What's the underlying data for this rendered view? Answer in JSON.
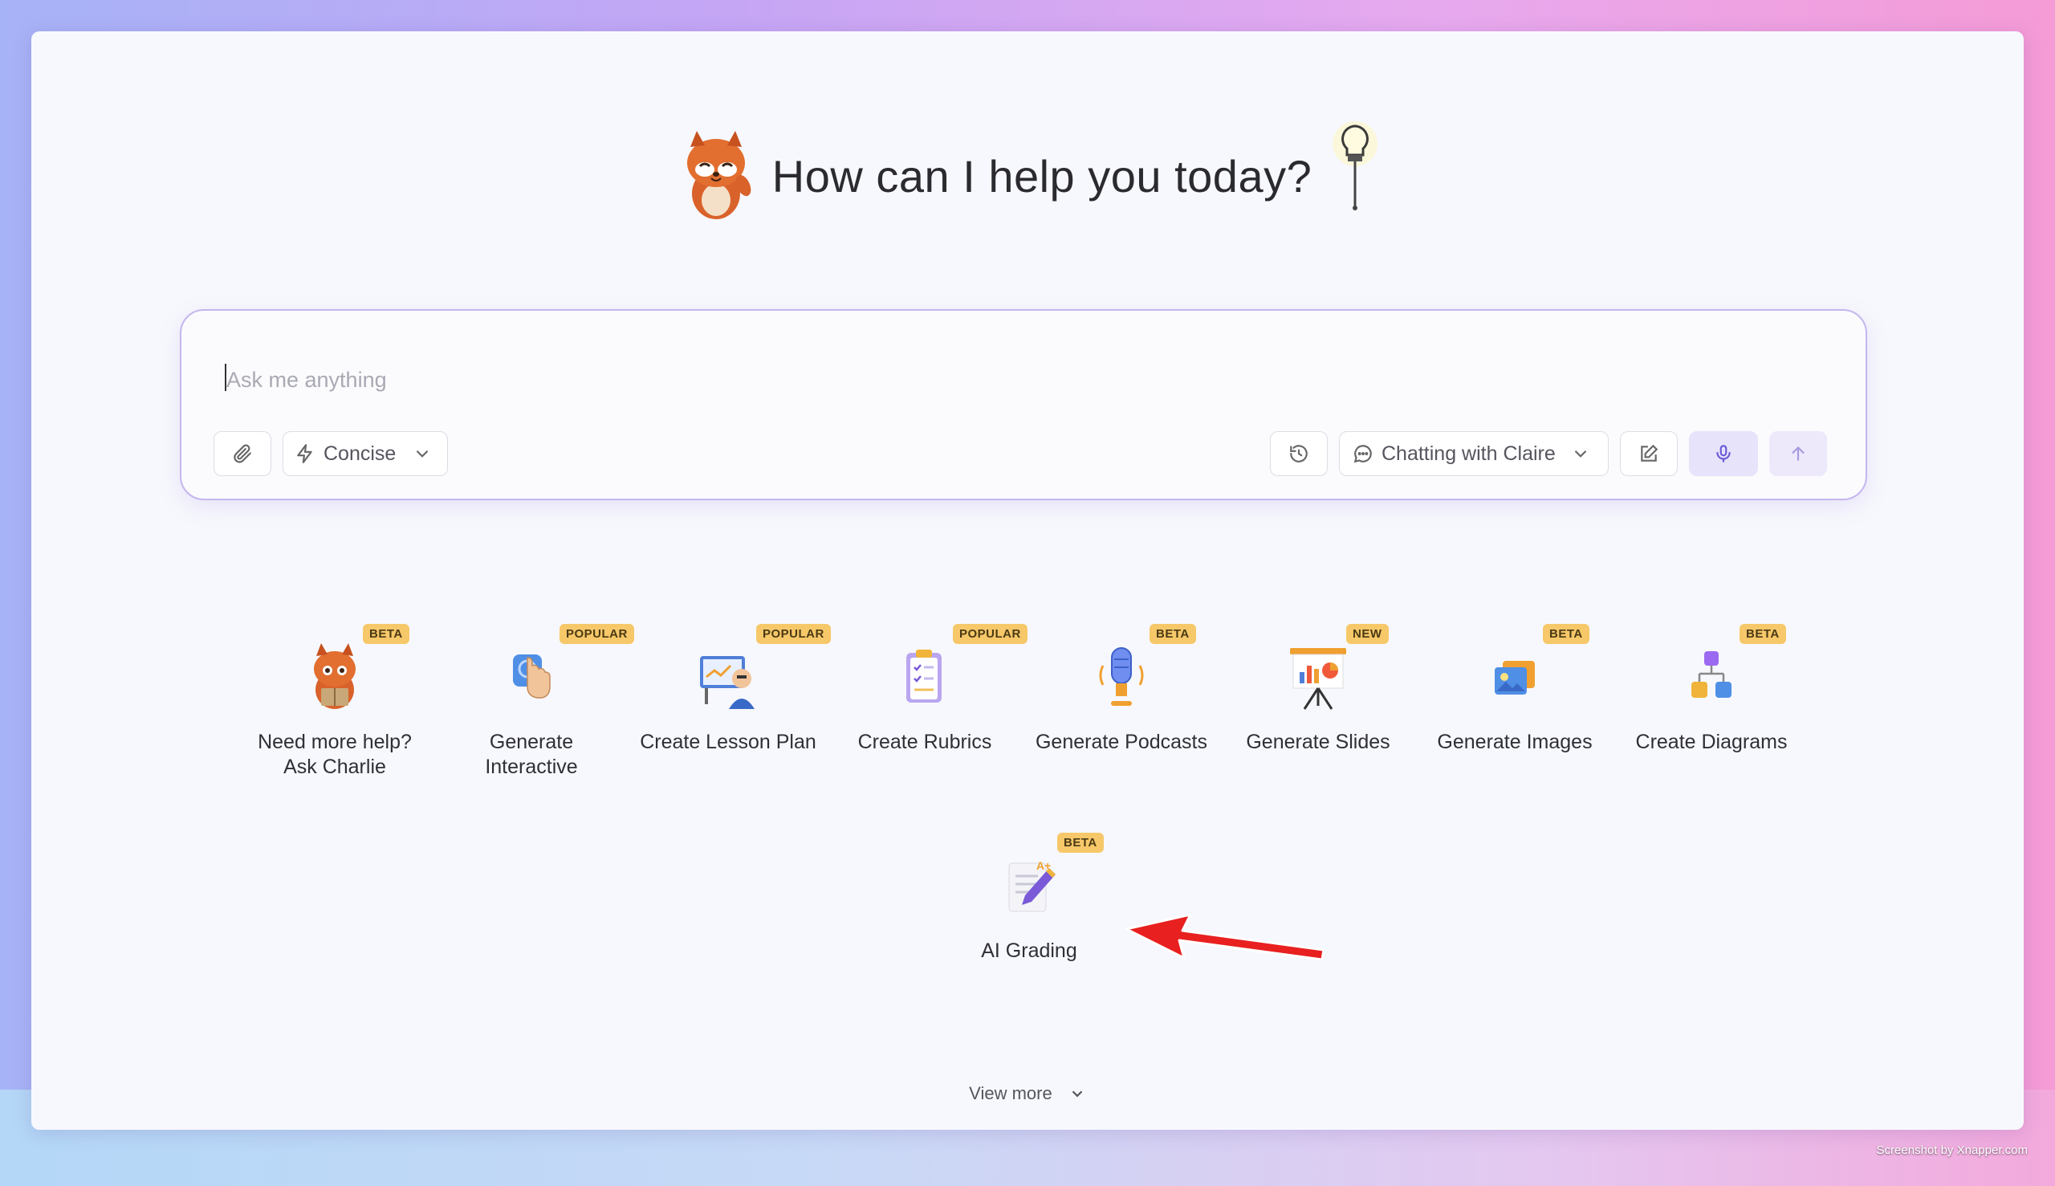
{
  "header": {
    "title": "How can I help you today?"
  },
  "chat": {
    "placeholder": "Ask me anything",
    "mode_label": "Concise",
    "chatting_label": "Chatting with Claire"
  },
  "tools": [
    {
      "label": "Need more help?\nAsk Charlie",
      "badge": "BETA",
      "icon": "fox-reading-icon"
    },
    {
      "label": "Generate\nInteractive",
      "badge": "POPULAR",
      "icon": "tap-hand-icon"
    },
    {
      "label": "Create Lesson Plan",
      "badge": "POPULAR",
      "icon": "teacher-board-icon"
    },
    {
      "label": "Create Rubrics",
      "badge": "POPULAR",
      "icon": "clipboard-icon"
    },
    {
      "label": "Generate Podcasts",
      "badge": "BETA",
      "icon": "microphone-icon"
    },
    {
      "label": "Generate Slides",
      "badge": "NEW",
      "icon": "presentation-icon"
    },
    {
      "label": "Generate Images",
      "badge": "BETA",
      "icon": "images-icon"
    },
    {
      "label": "Create Diagrams",
      "badge": "BETA",
      "icon": "diagram-icon"
    },
    {
      "label": "AI Grading",
      "badge": "BETA",
      "icon": "grading-pen-icon"
    }
  ],
  "footer": {
    "view_more": "View more"
  },
  "credit": "Screenshot by Xnapper.com",
  "colors": {
    "accent": "#6a5ad8",
    "badge": "#f7c869",
    "annotation_arrow": "#e8201f"
  }
}
